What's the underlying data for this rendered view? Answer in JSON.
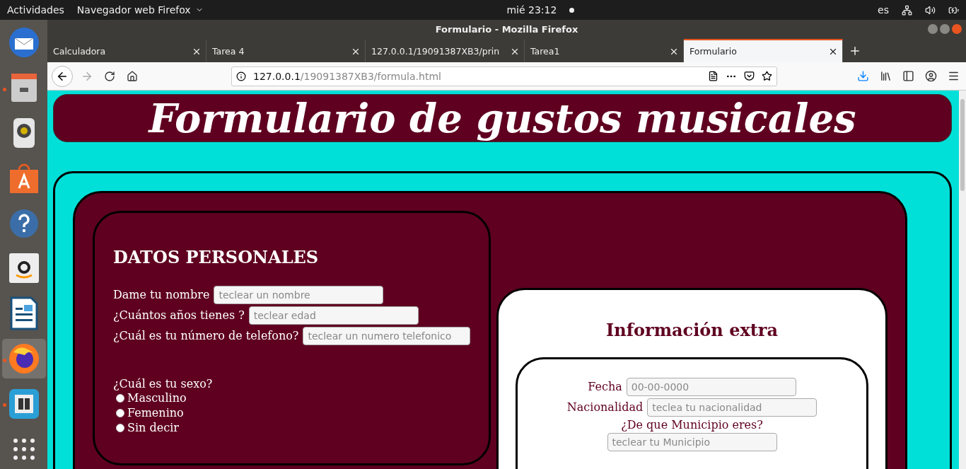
{
  "top_bar": {
    "activities": "Actividades",
    "app_menu": "Navegador web Firefox",
    "clock": "mié 23:12",
    "keyboard_layout": "es"
  },
  "dock": [
    {
      "kind": "mail",
      "running": false,
      "selected": false
    },
    {
      "kind": "files",
      "running": true,
      "selected": false
    },
    {
      "kind": "speaker",
      "running": false,
      "selected": false
    },
    {
      "kind": "store",
      "running": false,
      "selected": false
    },
    {
      "kind": "help",
      "running": false,
      "selected": false
    },
    {
      "kind": "amazon",
      "running": false,
      "selected": false
    },
    {
      "kind": "writer",
      "running": false,
      "selected": false
    },
    {
      "kind": "firefox",
      "running": true,
      "selected": true
    },
    {
      "kind": "window",
      "running": true,
      "selected": false
    },
    {
      "kind": "apps",
      "running": false,
      "selected": false
    }
  ],
  "window": {
    "title": "Formulario - Mozilla Firefox"
  },
  "tabs": [
    {
      "label": "Calculadora",
      "selected": false
    },
    {
      "label": "Tarea 4",
      "selected": false
    },
    {
      "label": "127.0.0.1/19091387XB3/prin",
      "selected": false
    },
    {
      "label": "Tarea1",
      "selected": false
    },
    {
      "label": "Formulario",
      "selected": true
    }
  ],
  "address": {
    "host": "127.0.0.1",
    "path": "/19091387XB3/formula.html"
  },
  "page": {
    "title": "Formulario de gustos musicales",
    "personal": {
      "heading": "DATOS PERSONALES",
      "fields": [
        {
          "label": "Dame tu nombre",
          "placeholder": "teclear un nombre"
        },
        {
          "label": "¿Cuántos años tienes ?",
          "placeholder": "teclear edad"
        },
        {
          "label": "¿Cuál es tu número de telefono?",
          "placeholder": "teclear un numero telefonico"
        }
      ],
      "sex_question": "¿Cuál es tu sexo?",
      "sex_options": [
        {
          "label": "Masculino",
          "selected": false
        },
        {
          "label": "Femenino",
          "selected": false
        },
        {
          "label": "Sin decir",
          "selected": false
        }
      ]
    },
    "extra": {
      "heading": "Información extra",
      "fields": [
        {
          "label": "Fecha",
          "placeholder": "00-00-0000"
        },
        {
          "label": "Nacionalidad",
          "placeholder": "teclea tu nacionalidad"
        }
      ],
      "municipio_question": "¿De que Municipio eres?",
      "municipio_placeholder": "teclear tu Municipio"
    }
  }
}
